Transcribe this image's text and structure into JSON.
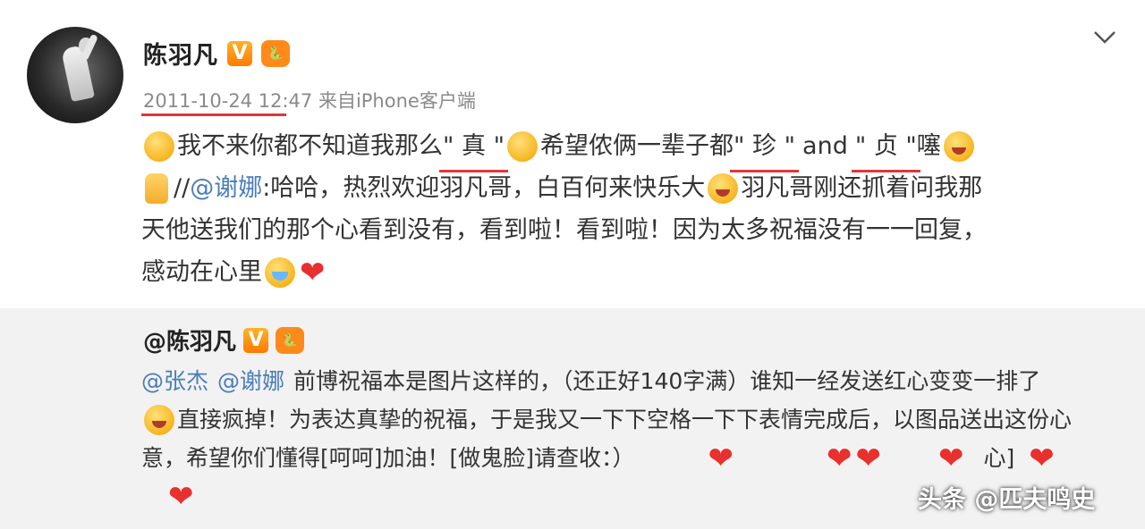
{
  "post": {
    "author": "陈羽凡",
    "verified_badge": "V",
    "extra_badge": "🐍",
    "timestamp": "2011-10-24 12:47",
    "source_prefix": "来自",
    "source": "iPhone客户端",
    "line1": {
      "t1": "我不来你都不知道我那么",
      "q1": "\" 真 \"",
      "t2": "希望侬俩一辈子都",
      "q2": "\" 珍 \"",
      "and": "and",
      "q3": "\" 贞 \"",
      "t3": "噻"
    },
    "line2": {
      "t1": "//",
      "mention": "@谢娜",
      "t2": ":哈哈，热烈欢迎羽凡哥，白百何来快乐大",
      "t3": "羽凡哥刚还抓着问我那"
    },
    "line3": "天他送我们的那个心看到没有，看到啦！看到啦！因为太多祝福没有一一回复，",
    "line4": "感动在心里"
  },
  "repost": {
    "author": "@陈羽凡",
    "verified_badge": "V",
    "extra_badge": "🐍",
    "line1": {
      "mention1": "@张杰",
      "mention2": "@谢娜",
      "text": "前博祝福本是图片这样的，（还正好140字满）谁知一经发送红心变变一排了"
    },
    "line2": "直接疯掉！为表达真挚的祝福，于是我又一下下空格一下下表情完成后，以图品送出这份心",
    "line3": "意，希望你们懂得[呵呵]加油！[做鬼脸]请查收：）",
    "line3_tail": "心]"
  },
  "watermark": "头条 @匹夫鸣史",
  "icons": {
    "chevron": "chevron-down-icon",
    "heart": "heart-icon",
    "emoji": "emoji-icon",
    "thumb": "thumbs-up-icon"
  },
  "colors": {
    "accent_red": "#e0363b",
    "mention_blue": "#4a7db8",
    "vip_orange": "#ff8a1a"
  }
}
